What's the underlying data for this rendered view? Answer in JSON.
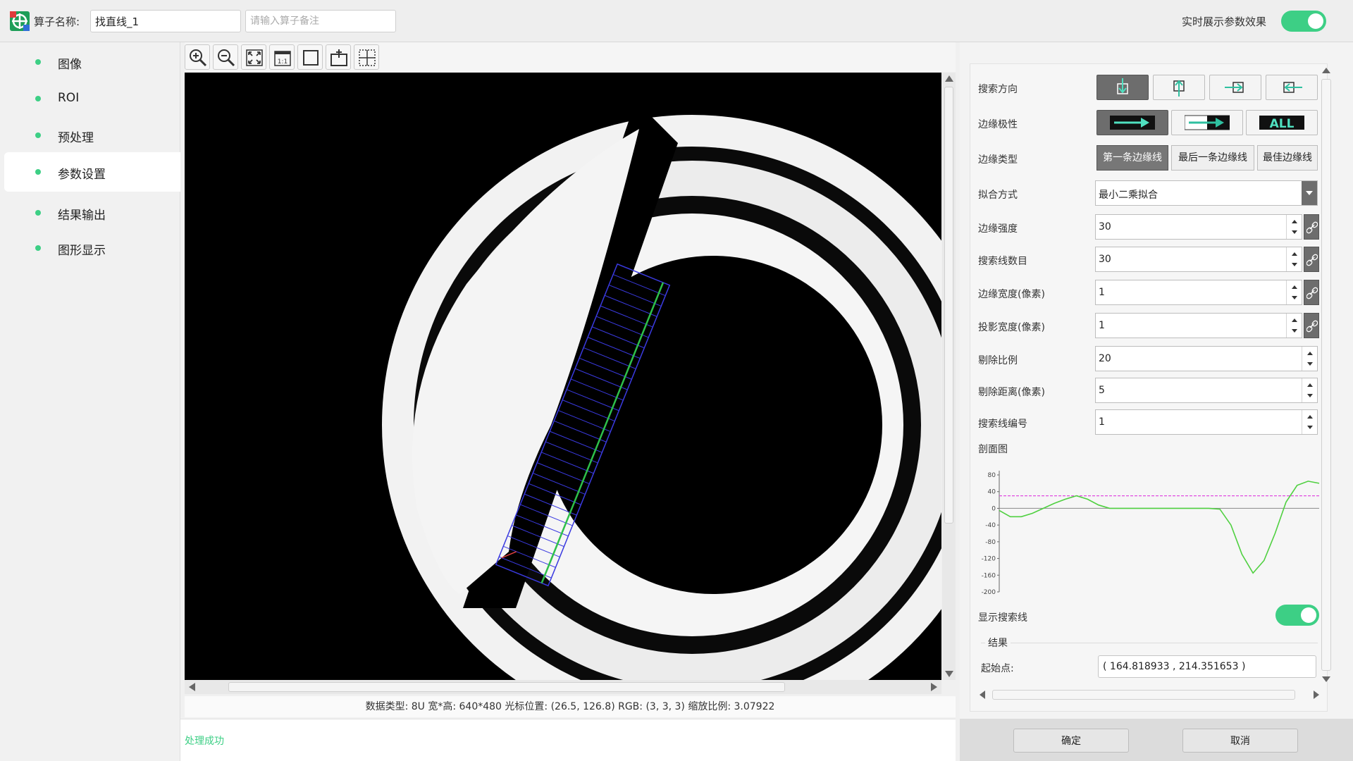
{
  "header": {
    "name_label": "算子名称:",
    "name_value": "找直线_1",
    "remark_placeholder": "请输入算子备注",
    "realtime_label": "实时展示参数效果",
    "realtime_on": true
  },
  "sidebar": {
    "items": [
      {
        "label": "图像"
      },
      {
        "label": "ROI"
      },
      {
        "label": "预处理"
      },
      {
        "label": "参数设置"
      },
      {
        "label": "结果输出"
      },
      {
        "label": "图形显示"
      }
    ],
    "active_index": 3
  },
  "toolbar": {
    "tools": [
      "zoom-in-icon",
      "zoom-out-icon",
      "fit-window-icon",
      "actual-size-icon",
      "rectangle-icon",
      "annotate-icon",
      "crosshair-icon"
    ]
  },
  "status": {
    "info": "数据类型: 8U 宽*高: 640*480 光标位置: (26.5, 126.8) RGB: (3, 3, 3) 缩放比例: 3.07922",
    "message": "处理成功",
    "message_color": "#3dcf85"
  },
  "params": {
    "search_direction": {
      "label": "搜索方向",
      "selected": 0
    },
    "edge_polarity": {
      "label": "边缘极性",
      "selected": 0,
      "all_text": "ALL"
    },
    "edge_type": {
      "label": "边缘类型",
      "options": [
        "第一条边缘线",
        "最后一条边缘线",
        "最佳边缘线"
      ],
      "selected": 0
    },
    "fit_method": {
      "label": "拟合方式",
      "value": "最小二乘拟合"
    },
    "edge_strength": {
      "label": "边缘强度",
      "value": "30"
    },
    "search_line_count": {
      "label": "搜索线数目",
      "value": "30"
    },
    "edge_width": {
      "label": "边缘宽度(像素)",
      "value": "1"
    },
    "projection_width": {
      "label": "投影宽度(像素)",
      "value": "1"
    },
    "reject_ratio": {
      "label": "剔除比例",
      "value": "20"
    },
    "reject_distance": {
      "label": "剔除距离(像素)",
      "value": "5"
    },
    "search_line_index": {
      "label": "搜索线编号",
      "value": "1"
    },
    "profile_label": "剖面图",
    "show_search_line": {
      "label": "显示搜索线",
      "on": true
    },
    "result_label": "结果",
    "start_point": {
      "label": "起始点:",
      "value": "( 164.818933 , 214.351653 )"
    }
  },
  "footer": {
    "confirm": "确定",
    "cancel": "取消"
  },
  "chart_data": {
    "type": "line",
    "title": "",
    "xlabel": "",
    "ylabel": "",
    "ylim": [
      -200,
      80
    ],
    "yticks": [
      80,
      40,
      0,
      -40,
      -80,
      -120,
      -160,
      -200
    ],
    "threshold": 30,
    "x": [
      0,
      1,
      2,
      3,
      4,
      5,
      6,
      7,
      8,
      9,
      10,
      11,
      12,
      13,
      14,
      15,
      16,
      17,
      18,
      19,
      20,
      21,
      22,
      23,
      24,
      25,
      26,
      27,
      28,
      29
    ],
    "series": [
      {
        "values": [
          -5,
          -20,
          -20,
          -12,
          0,
          12,
          22,
          30,
          22,
          8,
          0,
          0,
          0,
          0,
          0,
          0,
          0,
          0,
          0,
          0,
          -2,
          -40,
          -110,
          -155,
          -125,
          -60,
          15,
          55,
          65,
          60
        ]
      }
    ],
    "colors": {
      "line": "#4fd040",
      "threshold": "#e04de0",
      "zero": "#888888"
    }
  }
}
